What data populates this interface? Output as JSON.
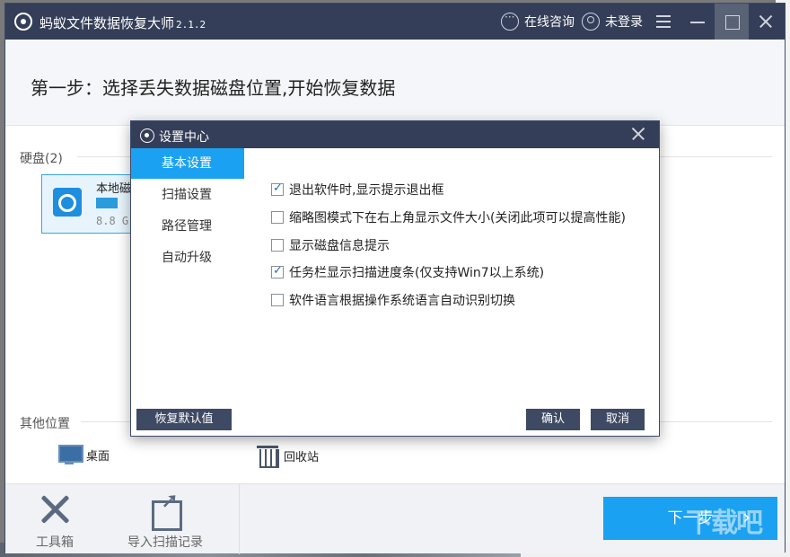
{
  "app": {
    "title": "蚂蚁文件数据恢复大师",
    "version": "2.1.2",
    "online_consult": "在线咨询",
    "login_status": "未登录"
  },
  "step": {
    "title": "第一步：选择丢失数据磁盘位置,开始恢复数据"
  },
  "disks": {
    "section_label": "硬盘(2)",
    "items": [
      {
        "name": "本地磁",
        "size": "8.8 G"
      }
    ]
  },
  "other_locations": {
    "section_label": "其他位置",
    "items": [
      {
        "label": "桌面",
        "icon": "monitor-icon"
      },
      {
        "label": "回收站",
        "icon": "trash-icon"
      }
    ]
  },
  "footer": {
    "toolbox_label": "工具箱",
    "import_label": "导入扫描记录",
    "next_label": "下一步",
    "watermark": "下载吧"
  },
  "dialog": {
    "title": "设置中心",
    "nav": [
      {
        "label": "基本设置",
        "active": true
      },
      {
        "label": "扫描设置",
        "active": false
      },
      {
        "label": "路径管理",
        "active": false
      },
      {
        "label": "自动升级",
        "active": false
      }
    ],
    "options": [
      {
        "label": "退出软件时,显示提示退出框",
        "checked": true
      },
      {
        "label": "缩略图模式下在右上角显示文件大小(关闭此项可以提高性能)",
        "checked": false
      },
      {
        "label": "显示磁盘信息提示",
        "checked": false
      },
      {
        "label": "任务栏显示扫描进度条(仅支持Win7以上系统)",
        "checked": true
      },
      {
        "label": "软件语言根据操作系统语言自动识别切换",
        "checked": false
      }
    ],
    "restore_defaults": "恢复默认值",
    "confirm": "确认",
    "cancel": "取消"
  },
  "colors": {
    "titlebar": "#343e58",
    "accent": "#1ba1f2",
    "dialog_button": "#3e4a64"
  }
}
